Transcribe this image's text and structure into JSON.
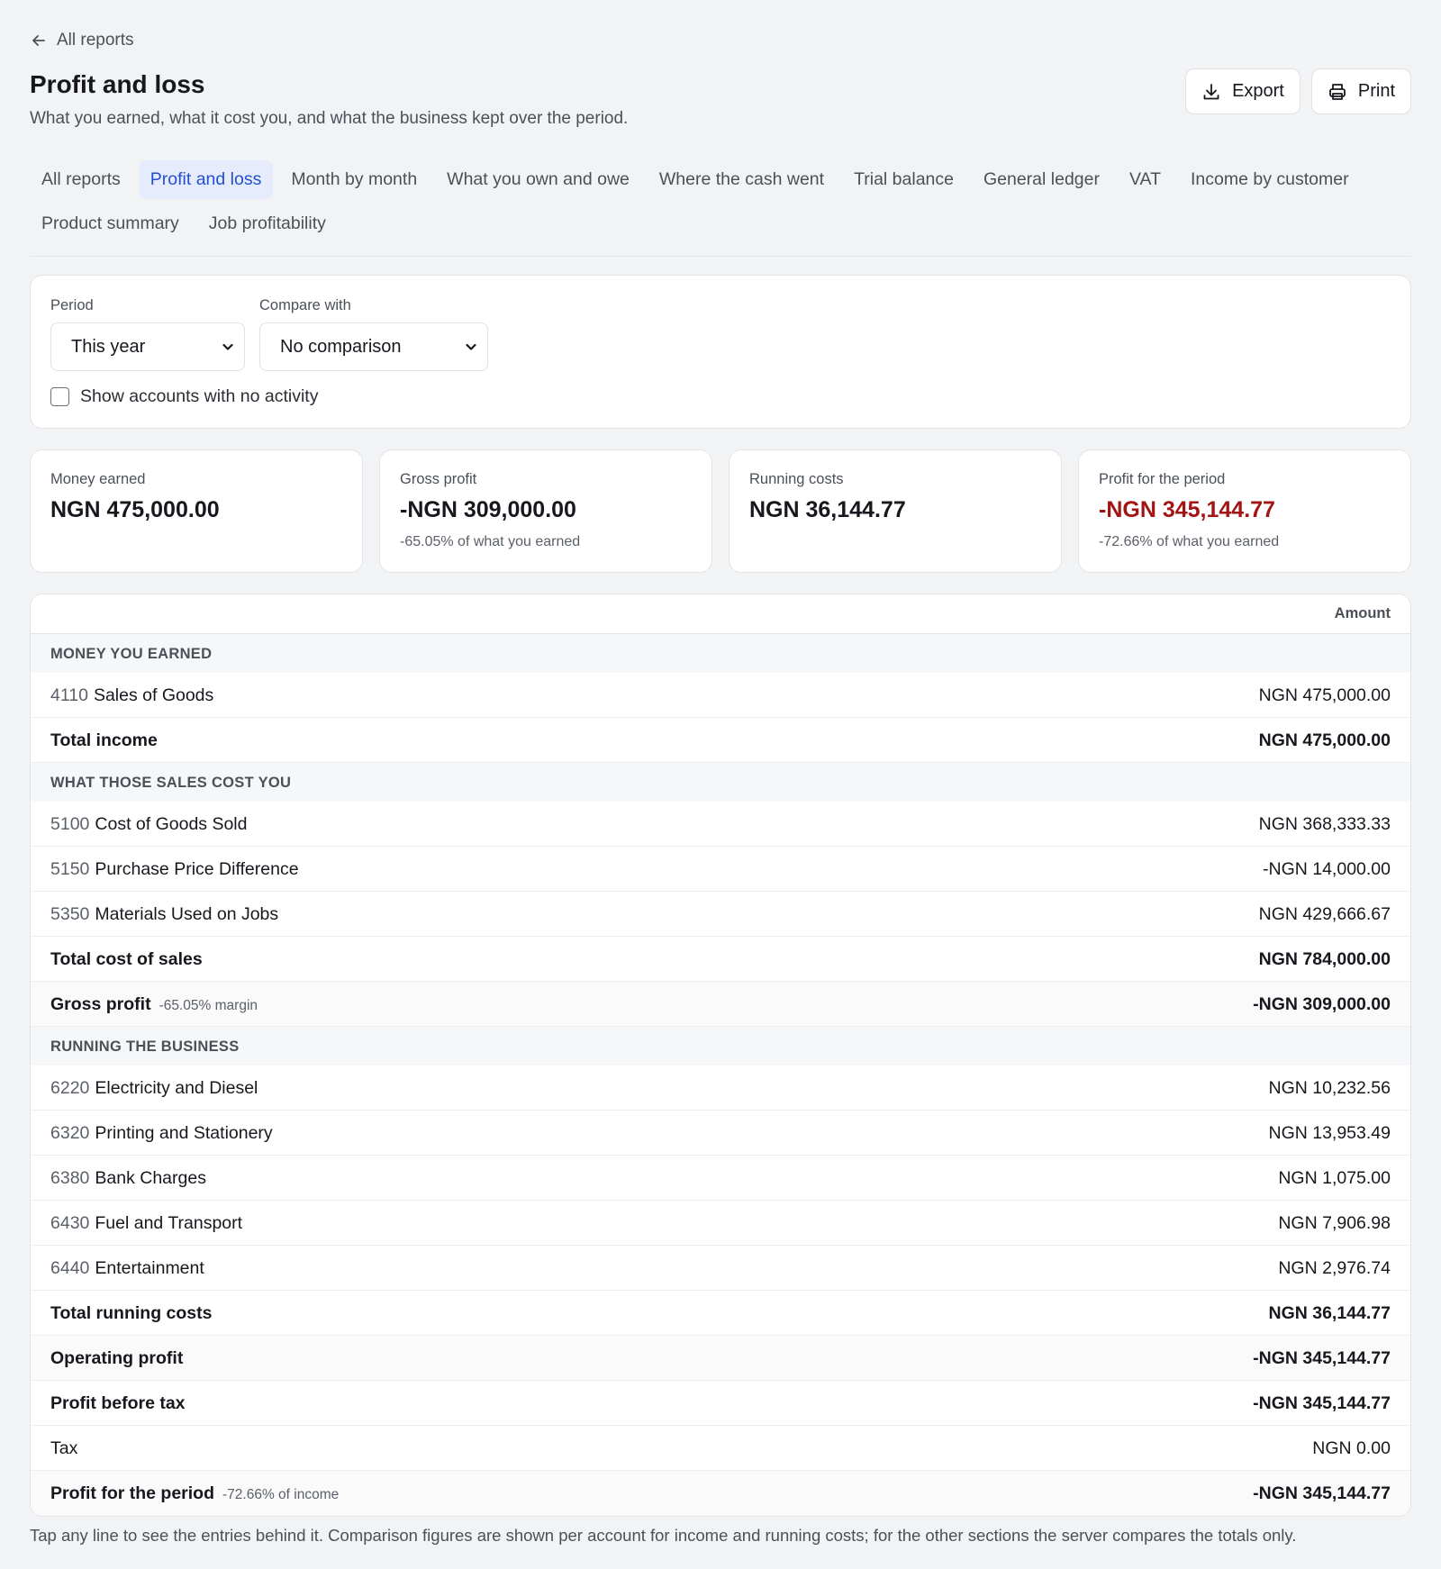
{
  "back_link": "All reports",
  "title": "Profit and loss",
  "subtitle": "What you earned, what it cost you, and what the business kept over the period.",
  "actions": {
    "export": "Export",
    "print": "Print"
  },
  "tabs": [
    {
      "label": "All reports",
      "active": false
    },
    {
      "label": "Profit and loss",
      "active": true
    },
    {
      "label": "Month by month",
      "active": false
    },
    {
      "label": "What you own and owe",
      "active": false
    },
    {
      "label": "Where the cash went",
      "active": false
    },
    {
      "label": "Trial balance",
      "active": false
    },
    {
      "label": "General ledger",
      "active": false
    },
    {
      "label": "VAT",
      "active": false
    },
    {
      "label": "Income by customer",
      "active": false
    },
    {
      "label": "Product summary",
      "active": false
    },
    {
      "label": "Job profitability",
      "active": false
    }
  ],
  "filters": {
    "period_label": "Period",
    "period_value": "This year",
    "compare_label": "Compare with",
    "compare_value": "No comparison",
    "show_inactive_label": "Show accounts with no activity",
    "show_inactive_checked": false
  },
  "cards": [
    {
      "label": "Money earned",
      "value": "NGN 475,000.00",
      "note": "",
      "negative": false
    },
    {
      "label": "Gross profit",
      "value": "-NGN 309,000.00",
      "note": "-65.05% of what you earned",
      "negative": false
    },
    {
      "label": "Running costs",
      "value": "NGN 36,144.77",
      "note": "",
      "negative": false
    },
    {
      "label": "Profit for the period",
      "value": "-NGN 345,144.77",
      "note": "-72.66% of what you earned",
      "negative": true
    }
  ],
  "table": {
    "amount_header": "Amount",
    "rows": [
      {
        "type": "section",
        "label": "MONEY YOU EARNED"
      },
      {
        "type": "account",
        "code": "4110",
        "label": "Sales of Goods",
        "amount": "NGN 475,000.00"
      },
      {
        "type": "total",
        "label": "Total income",
        "amount": "NGN 475,000.00"
      },
      {
        "type": "section",
        "label": "WHAT THOSE SALES COST YOU"
      },
      {
        "type": "account",
        "code": "5100",
        "label": "Cost of Goods Sold",
        "amount": "NGN 368,333.33"
      },
      {
        "type": "account",
        "code": "5150",
        "label": "Purchase Price Difference",
        "amount": "-NGN 14,000.00"
      },
      {
        "type": "account",
        "code": "5350",
        "label": "Materials Used on Jobs",
        "amount": "NGN 429,666.67"
      },
      {
        "type": "total",
        "label": "Total cost of sales",
        "amount": "NGN 784,000.00"
      },
      {
        "type": "summary",
        "label": "Gross profit",
        "note": "-65.05% margin",
        "amount": "-NGN 309,000.00"
      },
      {
        "type": "section",
        "label": "RUNNING THE BUSINESS"
      },
      {
        "type": "account",
        "code": "6220",
        "label": "Electricity and Diesel",
        "amount": "NGN 10,232.56"
      },
      {
        "type": "account",
        "code": "6320",
        "label": "Printing and Stationery",
        "amount": "NGN 13,953.49"
      },
      {
        "type": "account",
        "code": "6380",
        "label": "Bank Charges",
        "amount": "NGN 1,075.00"
      },
      {
        "type": "account",
        "code": "6430",
        "label": "Fuel and Transport",
        "amount": "NGN 7,906.98"
      },
      {
        "type": "account",
        "code": "6440",
        "label": "Entertainment",
        "amount": "NGN 2,976.74"
      },
      {
        "type": "total",
        "label": "Total running costs",
        "amount": "NGN 36,144.77"
      },
      {
        "type": "summary",
        "label": "Operating profit",
        "note": "",
        "amount": "-NGN 345,144.77"
      },
      {
        "type": "total",
        "label": "Profit before tax",
        "amount": "-NGN 345,144.77"
      },
      {
        "type": "total",
        "label": "Tax",
        "amount": "NGN 0.00",
        "plain": true
      },
      {
        "type": "summary",
        "label": "Profit for the period",
        "note": "-72.66% of income",
        "amount": "-NGN 345,144.77"
      }
    ]
  },
  "footnote": "Tap any line to see the entries behind it. Comparison figures are shown per account for income and running costs; for the other sections the server compares the totals only.",
  "colors": {
    "accent": "#2450d0",
    "accent_bg": "#e6ecfb",
    "negative": "#a31515"
  }
}
